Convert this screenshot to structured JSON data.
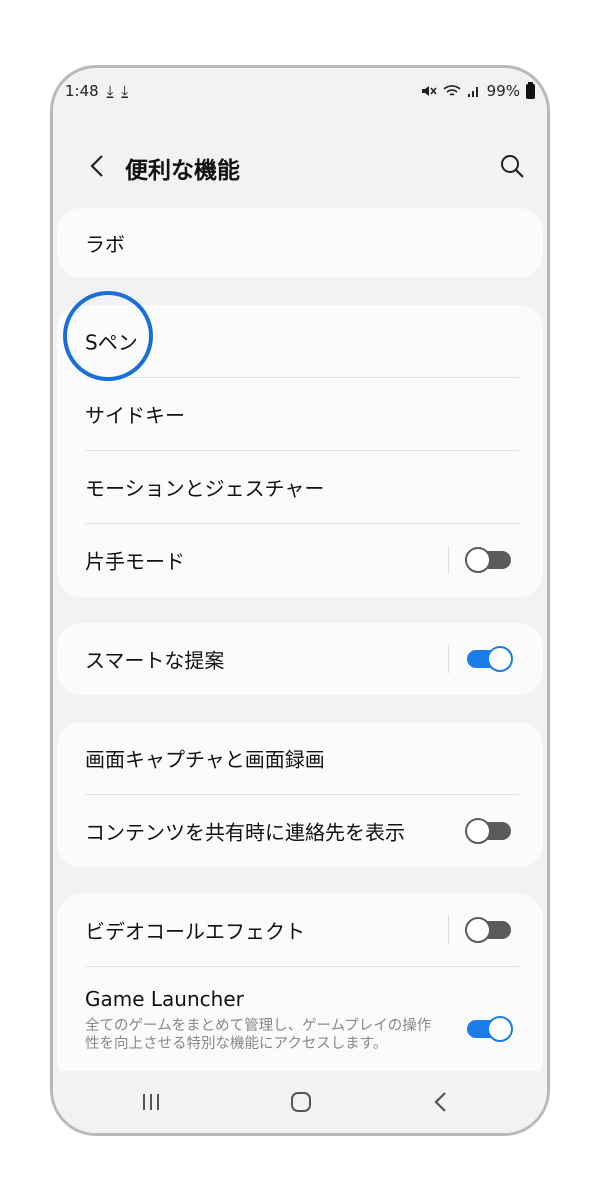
{
  "status": {
    "time": "1:48",
    "download_glyph": "⤓",
    "battery_text": "99%"
  },
  "header": {
    "title": "便利な機能",
    "back_icon": "chevron-left-icon",
    "search_icon": "search-icon"
  },
  "items": {
    "labs": "ラボ",
    "s_pen": "Sペン",
    "side_key": "サイドキー",
    "motions_gestures": "モーションとジェスチャー",
    "one_handed": "片手モード",
    "smart_suggestions": "スマートな提案",
    "screenshots": "画面キャプチャと画面録画",
    "show_contacts_share": "コンテンツを共有時に連絡先を表示",
    "video_call_effects": "ビデオコールエフェクト",
    "game_launcher": "Game Launcher",
    "game_launcher_desc": "全てのゲームをまとめて管理し、ゲームプレイの操作性を向上させる特別な機能にアクセスします。"
  },
  "toggles": {
    "one_handed": false,
    "smart_suggestions": true,
    "show_contacts_share": false,
    "video_call_effects": false,
    "game_launcher": true
  },
  "colors": {
    "accent": "#1a7dea",
    "highlight_circle": "#1a6fd6"
  }
}
